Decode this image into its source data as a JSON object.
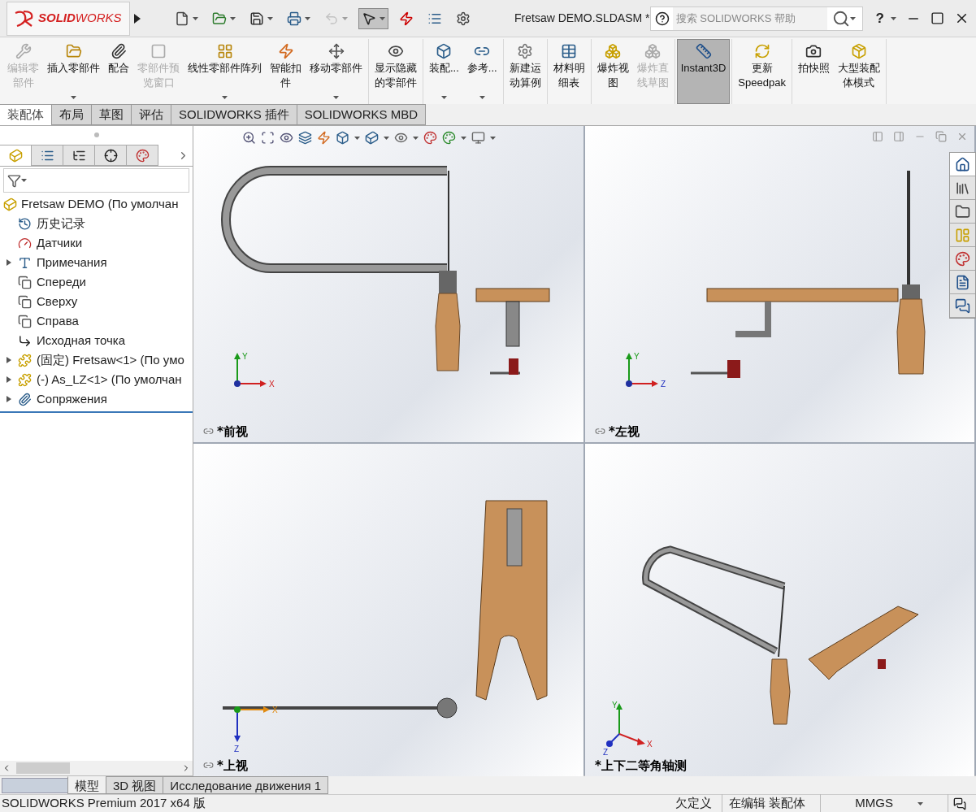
{
  "window": {
    "logo": "**SOLID**WORKS",
    "title": "Fretsaw DEMO.SLDASM *",
    "search": {
      "placeholder": "搜索 SOLIDWORKS 帮助"
    },
    "help": "?"
  },
  "quick_toolbar": [
    {
      "kind": "new",
      "disabled": false,
      "selected": false
    },
    {
      "kind": "open",
      "disabled": false,
      "selected": false
    },
    {
      "kind": "save",
      "disabled": false,
      "selected": false
    },
    {
      "kind": "print",
      "disabled": false,
      "selected": false
    },
    {
      "kind": "undo",
      "disabled": true,
      "selected": false
    },
    {
      "kind": "select",
      "disabled": false,
      "selected": true
    },
    {
      "kind": "rebuild",
      "disabled": false,
      "selected": false
    },
    {
      "kind": "file-props",
      "disabled": false,
      "selected": false
    },
    {
      "kind": "options",
      "disabled": false,
      "selected": false
    }
  ],
  "ribbon": {
    "groups": [
      [
        {
          "kind": "edit",
          "lines": [
            "编辑零",
            "部件"
          ],
          "disabled": true,
          "dropdown": false,
          "selected": false
        },
        {
          "kind": "insert",
          "lines": [
            "插入零部件"
          ],
          "disabled": false,
          "dropdown": true,
          "selected": false
        },
        {
          "kind": "mate",
          "lines": [
            "配合"
          ],
          "disabled": false,
          "dropdown": false,
          "selected": false
        },
        {
          "kind": "preview",
          "lines": [
            "零部件预",
            "览窗口"
          ],
          "disabled": true,
          "dropdown": false,
          "selected": false
        },
        {
          "kind": "pattern",
          "lines": [
            "线性零部件阵列"
          ],
          "disabled": false,
          "dropdown": true,
          "selected": false
        },
        {
          "kind": "fastener",
          "lines": [
            "智能扣",
            "件"
          ],
          "disabled": false,
          "dropdown": false,
          "selected": false
        },
        {
          "kind": "move",
          "lines": [
            "移动零部件"
          ],
          "disabled": false,
          "dropdown": true,
          "selected": false
        }
      ],
      [
        {
          "kind": "showhide",
          "lines": [
            "显示隐藏",
            "的零部件"
          ],
          "disabled": false,
          "dropdown": false,
          "selected": false
        }
      ],
      [
        {
          "kind": "assembly",
          "lines": [
            "装配..."
          ],
          "disabled": false,
          "dropdown": true,
          "selected": false
        },
        {
          "kind": "reference",
          "lines": [
            "参考..."
          ],
          "disabled": false,
          "dropdown": true,
          "selected": false
        }
      ],
      [
        {
          "kind": "motion",
          "lines": [
            "新建运",
            "动算例"
          ],
          "disabled": false,
          "dropdown": false,
          "selected": false
        }
      ],
      [
        {
          "kind": "bom",
          "lines": [
            "材料明",
            "细表"
          ],
          "disabled": false,
          "dropdown": false,
          "selected": false
        }
      ],
      [
        {
          "kind": "explode",
          "lines": [
            "爆炸视",
            "图"
          ],
          "disabled": false,
          "dropdown": false,
          "selected": false
        },
        {
          "kind": "explode-sketch",
          "lines": [
            "爆炸直",
            "线草图"
          ],
          "disabled": true,
          "dropdown": false,
          "selected": false
        }
      ],
      [
        {
          "kind": "instant3d",
          "lines": [
            "Instant3D"
          ],
          "disabled": false,
          "dropdown": false,
          "selected": true
        }
      ],
      [
        {
          "kind": "speedpak",
          "lines": [
            "更新",
            "Speedpak"
          ],
          "disabled": false,
          "dropdown": false,
          "selected": false
        }
      ],
      [
        {
          "kind": "snapshot",
          "lines": [
            "拍快照"
          ],
          "disabled": false,
          "dropdown": false,
          "selected": false
        },
        {
          "kind": "large",
          "lines": [
            "大型装配",
            "体模式"
          ],
          "disabled": false,
          "dropdown": false,
          "selected": false
        }
      ]
    ]
  },
  "tabs": [
    {
      "label": "装配体",
      "selected": true
    },
    {
      "label": "布局",
      "selected": false
    },
    {
      "label": "草图",
      "selected": false
    },
    {
      "label": "评估",
      "selected": false
    },
    {
      "label": "SOLIDWORKS 插件",
      "selected": false
    },
    {
      "label": "SOLIDWORKS MBD",
      "selected": false
    }
  ],
  "panel_tabs": [
    {
      "kind": "tree",
      "selected": true
    },
    {
      "kind": "properties",
      "selected": false
    },
    {
      "kind": "config",
      "selected": false
    },
    {
      "kind": "dim",
      "selected": false
    },
    {
      "kind": "display",
      "selected": false
    }
  ],
  "tree": {
    "label": "Fretsaw DEMO  (По умолчан",
    "children": [
      {
        "kind": "history",
        "label": "历史记录"
      },
      {
        "kind": "sensors",
        "label": "Датчики"
      },
      {
        "kind": "annotations",
        "label": "Примечания",
        "expanded": false
      },
      {
        "kind": "plane",
        "label": "Спереди"
      },
      {
        "kind": "plane",
        "label": "Сверху"
      },
      {
        "kind": "plane",
        "label": "Справа"
      },
      {
        "kind": "origin",
        "label": "Исходная точка"
      },
      {
        "kind": "part",
        "label": "(固定) Fretsaw<1> (По умо",
        "expanded": false
      },
      {
        "kind": "part",
        "label": "(-) As_LZ<1> (По умолчан",
        "expanded": false
      },
      {
        "kind": "mates",
        "label": "Сопряжения",
        "expanded": false
      }
    ]
  },
  "viewports": [
    {
      "kind": "front",
      "label": "*前视",
      "linked": true,
      "axes": [
        "Y",
        "X"
      ]
    },
    {
      "kind": "left",
      "label": "*左视",
      "linked": true,
      "axes": [
        "Y",
        "Z"
      ]
    },
    {
      "kind": "top",
      "label": "*上视",
      "linked": true,
      "axes": [
        "X",
        "Z"
      ]
    },
    {
      "kind": "iso",
      "label": "*上下二等角轴测",
      "linked": false,
      "axes": [
        "Y",
        "X",
        "Z"
      ]
    }
  ],
  "task_pane": [
    {
      "kind": "home",
      "selected": true
    },
    {
      "kind": "library",
      "selected": false
    },
    {
      "kind": "folder",
      "selected": false
    },
    {
      "kind": "palette",
      "selected": false
    },
    {
      "kind": "appearance",
      "selected": false
    },
    {
      "kind": "properties",
      "selected": false
    },
    {
      "kind": "forum",
      "selected": false
    }
  ],
  "bottom_tabs": [
    {
      "label": "模型",
      "selected": true
    },
    {
      "label": "3D 视图",
      "selected": false
    },
    {
      "label": "Исследование движения 1",
      "selected": false
    }
  ],
  "status_bar": {
    "product": "SOLIDWORKS Premium 2017 x64 版",
    "state": "欠定义",
    "mode": "在编辑 装配体",
    "units": "MMGS"
  }
}
